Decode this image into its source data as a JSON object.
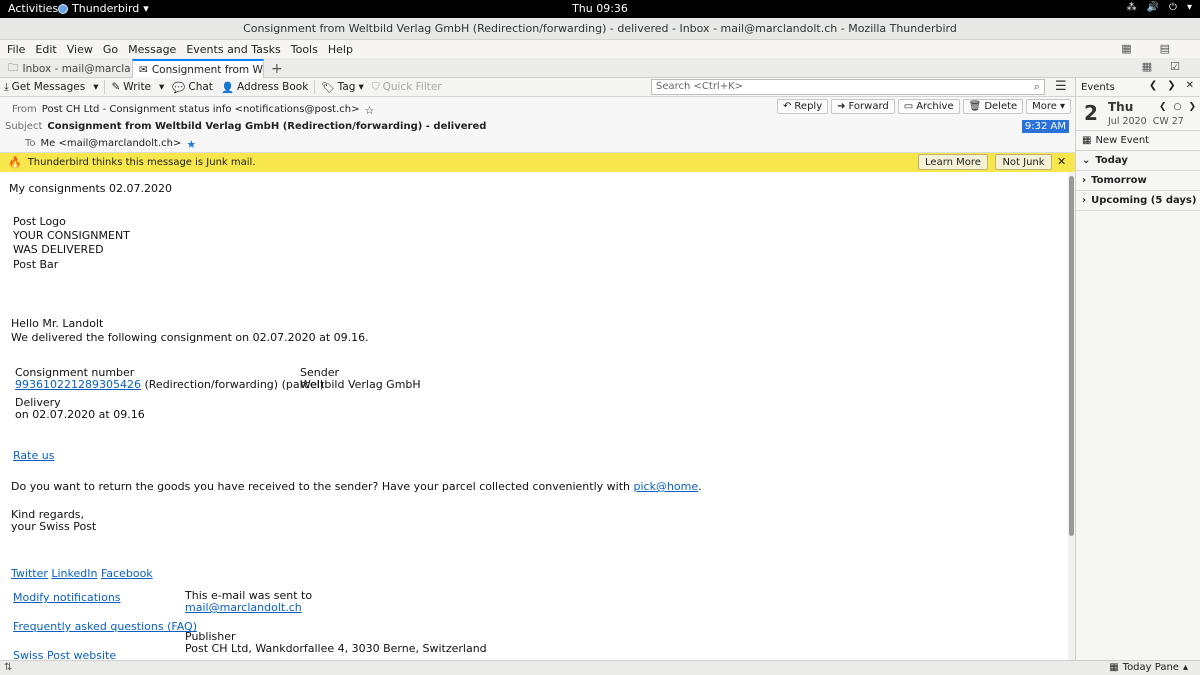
{
  "topbar": {
    "activities": "Activities",
    "app": "Thunderbird",
    "app_arrow": "▾",
    "clock": "Thu 09:36",
    "tray": [
      "⁂",
      "🔊",
      "⏻",
      "▾"
    ]
  },
  "window": {
    "title": "Consignment from Weltbild Verlag GmbH (Redirection/forwarding) - delivered - Inbox - mail@marclandolt.ch - Mozilla Thunderbird"
  },
  "menu": {
    "file": "File",
    "edit": "Edit",
    "view": "View",
    "go": "Go",
    "message": "Message",
    "events": "Events and Tasks",
    "tools": "Tools",
    "help": "Help"
  },
  "tabs": {
    "inbox": "Inbox - mail@marclandolt.ch",
    "message": "Consignment from Weltbild Verlag GmbH",
    "new_tab": "+"
  },
  "toolbar": {
    "get_messages": "Get Messages",
    "write": "Write",
    "chat": "Chat",
    "address_book": "Address Book",
    "tag": "Tag",
    "quick_filter": "Quick Filter",
    "search_placeholder": "Search <Ctrl+K>"
  },
  "header": {
    "from_label": "From",
    "from_value": "Post CH Ltd - Consignment status info <notifications@post.ch>",
    "subject_label": "Subject",
    "subject_value": "Consignment from Weltbild Verlag GmbH (Redirection/forwarding) - delivered",
    "to_label": "To",
    "to_value": "Me <mail@marclandolt.ch>",
    "time": "9:32 AM",
    "buttons": {
      "reply": "Reply",
      "forward": "Forward",
      "archive": "Archive",
      "delete": "Delete",
      "more": "More"
    }
  },
  "junk": {
    "message": "Thunderbird thinks this message is Junk mail.",
    "learn_more": "Learn More",
    "not_junk": "Not Junk",
    "close": "✕"
  },
  "body": {
    "heading": "My consignments 02.07.2020",
    "logo_lines": [
      "Post Logo",
      "YOUR CONSIGNMENT",
      "WAS DELIVERED",
      "Post Bar"
    ],
    "greeting": "Hello Mr. Landolt",
    "intro": "We delivered the following consignment on 02.07.2020 at 09.16.",
    "consignment_label": "Consignment number",
    "consignment_number": "993610221289305426",
    "consignment_type": " (Redirection/forwarding) (parcel)",
    "sender_label": "Sender",
    "sender_value": "Weltbild Verlag GmbH",
    "delivery_label": "Delivery",
    "delivery_value": "on 02.07.2020 at 09.16",
    "rate_us": "Rate us",
    "return_text": "Do you want to return the goods you have received to the sender? Have your parcel collected conveniently with ",
    "pickhome": "pick@home",
    "return_end": ".",
    "regards1": "Kind regards,",
    "regards2": "your Swiss Post",
    "social": [
      "Twitter",
      "LinkedIn",
      "Facebook"
    ],
    "modify_notifications": "Modify notifications",
    "faq": "Frequently asked questions (FAQ)",
    "website": "Swiss Post website",
    "sent_to_label": "This e-mail was sent to",
    "sent_to": "mail@marclandolt.ch",
    "publisher_label": "Publisher",
    "publisher_value": "Post CH Ltd, Wankdorfallee 4, 3030 Berne, Switzerland"
  },
  "events": {
    "title": "Events",
    "day": "2",
    "weekday": "Thu",
    "month_year": "Jul 2020",
    "cw": "CW 27",
    "new_event": "New Event",
    "sections": [
      "Today",
      "Tomorrow",
      "Upcoming (5 days)"
    ]
  },
  "status": {
    "today_pane": "Today Pane",
    "today_pane_arrow": "▴"
  }
}
